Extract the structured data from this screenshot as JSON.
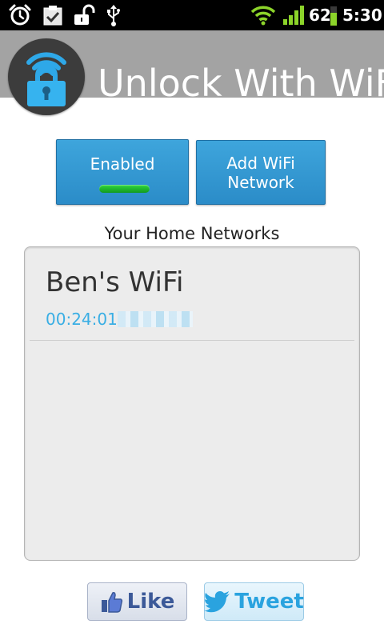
{
  "status_bar": {
    "battery_level": "62",
    "time": "5:30",
    "icons": [
      "alarm-icon",
      "checklist-icon",
      "unlocked-padlock-icon",
      "usb-icon",
      "wifi-signal-icon",
      "cell-signal-icon",
      "battery-icon"
    ]
  },
  "header": {
    "title": "Unlock With WiFi",
    "logo_icon": "wifi-padlock-logo-icon",
    "background_color": "#a3a3a3"
  },
  "controls": {
    "enabled_label": "Enabled",
    "enabled_indicator_color": "#2ed83c",
    "add_network_label_line1": "Add WiFi",
    "add_network_label_line2": "Network",
    "button_color": "#3ea5dc"
  },
  "networks": {
    "section_title": "Your Home Networks",
    "items": [
      {
        "name": "Ben's WiFi",
        "mac_prefix": "00:24:01"
      }
    ]
  },
  "social": {
    "like_label": "Like",
    "tweet_label": "Tweet",
    "like_icon": "thumbs-up-icon",
    "tweet_icon": "twitter-bird-icon"
  }
}
